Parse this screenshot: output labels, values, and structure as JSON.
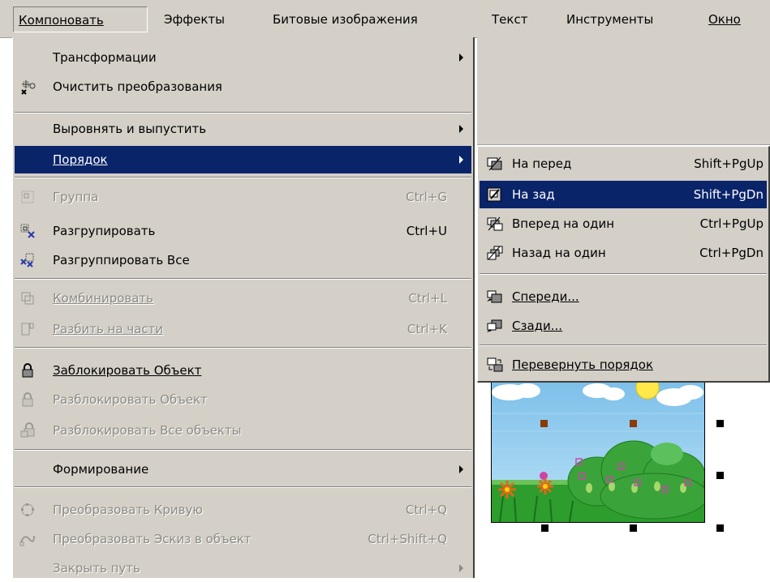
{
  "menubar": {
    "items": [
      {
        "label": "Компоновать",
        "accel": "К",
        "active": true
      },
      {
        "label": "Эффекты",
        "accel": "т",
        "active": false
      },
      {
        "label": "Битовые изображения",
        "accel": "Б",
        "active": false
      },
      {
        "label": "Текст",
        "accel": "Т",
        "active": false
      },
      {
        "label": "Инструменты",
        "accel": "н",
        "active": false
      },
      {
        "label": "Окно",
        "accel": "О",
        "active": false
      }
    ]
  },
  "menu": {
    "transform": {
      "label": "Трансформации",
      "icon": "transform-icon"
    },
    "clear_transform": {
      "label": "Очистить преобразования",
      "icon": "clear-transform-icon"
    },
    "align": {
      "label": "Выровнять и выпустить",
      "icon": ""
    },
    "order": {
      "label": "Порядок",
      "icon": ""
    },
    "group": {
      "label": "Группа",
      "shortcut": "Ctrl+G",
      "icon": "group-icon"
    },
    "ungroup": {
      "label": "Разгрупировать",
      "shortcut": "Ctrl+U",
      "icon": "ungroup-icon"
    },
    "ungroup_all": {
      "label": "Разгруппировать Все",
      "icon": "ungroup-all-icon"
    },
    "combine": {
      "label": "Комбинировать",
      "shortcut": "Ctrl+L",
      "icon": "combine-icon"
    },
    "break_apart": {
      "label": "Разбить  на части",
      "shortcut": "Ctrl+K",
      "icon": "break-apart-icon"
    },
    "lock": {
      "label": "Заблокировать Объект",
      "icon": "lock-icon"
    },
    "unlock": {
      "label": "Разблокировать Объект",
      "icon": "unlock-icon"
    },
    "unlock_all": {
      "label": "Разблокировать Все объекты",
      "icon": "unlock-all-icon"
    },
    "shaping": {
      "label": "Формирование",
      "icon": ""
    },
    "convert_curve": {
      "label": "Преобразовать Кривую",
      "shortcut": "Ctrl+Q",
      "icon": "convert-curve-icon"
    },
    "convert_outline": {
      "label": "Преобразовать Эскиз в объект",
      "shortcut": "Ctrl+Shift+Q",
      "icon": "convert-outline-icon"
    },
    "close_path": {
      "label": "Закрыть путь",
      "icon": ""
    }
  },
  "submenu": {
    "to_front": {
      "label": "На перед",
      "shortcut": "Shift+PgUp",
      "icon": "to-front-icon"
    },
    "to_back": {
      "label": "На зад",
      "shortcut": "Shift+PgDn",
      "icon": "to-back-icon"
    },
    "forward_one": {
      "label": "Вперед на один",
      "shortcut": "Ctrl+PgUp",
      "icon": "forward-one-icon"
    },
    "back_one": {
      "label": "Назад на один",
      "shortcut": "Ctrl+PgDn",
      "icon": "back-one-icon"
    },
    "in_front_of": {
      "label": "Спереди...",
      "icon": "in-front-of-icon"
    },
    "behind": {
      "label": "Сзади...",
      "icon": "behind-icon"
    },
    "reverse_order": {
      "label": "Перевернуть порядок",
      "icon": "reverse-order-icon"
    }
  },
  "colors": {
    "menu_bg": "#d4d0c8",
    "highlight": "#0a246a",
    "disabled_text": "#8c8a84",
    "sky": "#9fd0ee",
    "grass": "#2d9d2d"
  }
}
